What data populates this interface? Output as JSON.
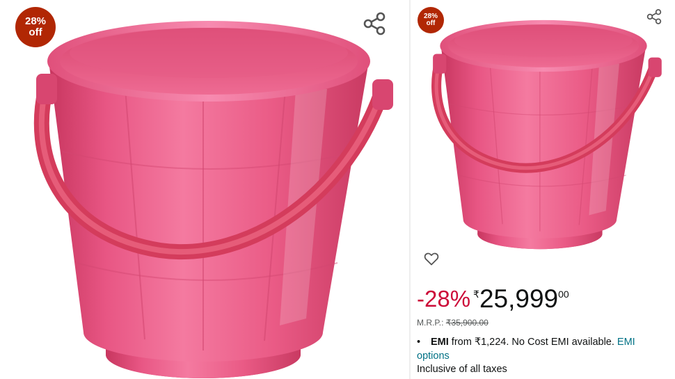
{
  "left_panel": {
    "badge": {
      "line1": "28%",
      "line2": "off"
    }
  },
  "right_panel": {
    "badge": {
      "line1": "28%",
      "line2": "off"
    },
    "price": {
      "discount": "-28%",
      "currency": "₹",
      "whole": "25,999",
      "fraction": "00"
    },
    "mrp": {
      "label": "M.R.P.:",
      "value": "₹35,900.00"
    },
    "emi": {
      "bullet": "•",
      "bold": "EMI",
      "text": " from ₹1,224. No Cost EMI available. ",
      "link": "EMI options"
    },
    "tax_note": "Inclusive of all taxes"
  },
  "icons": {
    "share": "share-icon",
    "wishlist": "heart-outline-icon"
  },
  "colors": {
    "badge": "#b12704",
    "discount": "#cc0c39",
    "link": "#007185",
    "bucket": "#ea5b85"
  }
}
